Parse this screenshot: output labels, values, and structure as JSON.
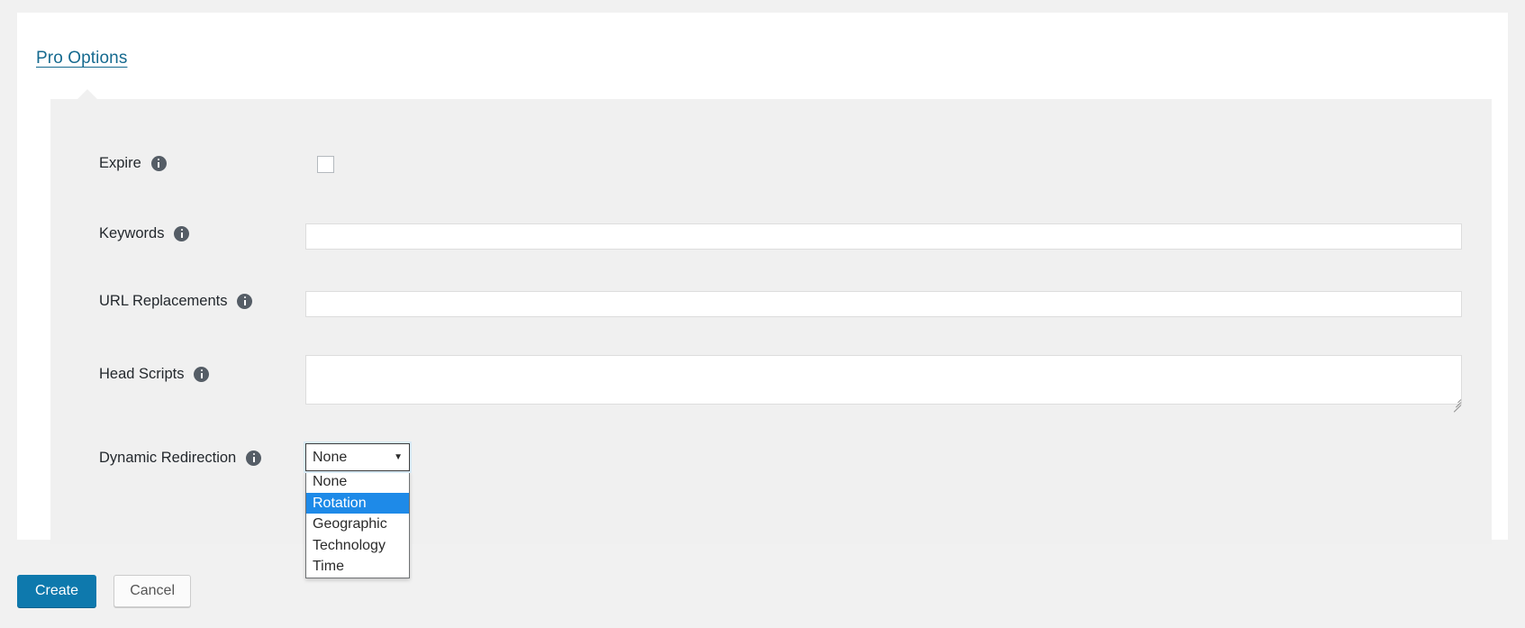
{
  "tab": {
    "label": "Pro Options"
  },
  "fields": [
    {
      "label": "Expire",
      "info_icon": "info-icon",
      "control": "checkbox",
      "value": "",
      "checked": false
    },
    {
      "label": "Keywords",
      "info_icon": "info-icon",
      "control": "text",
      "value": "",
      "placeholder": ""
    },
    {
      "label": "URL Replacements",
      "info_icon": "info-icon",
      "control": "text",
      "value": "",
      "placeholder": ""
    },
    {
      "label": "Head Scripts",
      "info_icon": "info-icon",
      "control": "textarea",
      "value": "",
      "placeholder": ""
    },
    {
      "label": "Dynamic Redirection",
      "info_icon": "info-icon",
      "control": "select",
      "value": "None"
    }
  ],
  "dropdown": {
    "selected_value": "None",
    "highlighted_option": "Rotation",
    "arrow_glyph": "▼",
    "options": [
      "None",
      "Rotation",
      "Geographic",
      "Technology",
      "Time"
    ]
  },
  "footer": {
    "create_label": "Create",
    "cancel_label": "Cancel"
  },
  "colors": {
    "link": "#156a8f",
    "primary_button": "#0e79ad",
    "highlight": "#1e8ae8",
    "panel_bg": "#f0f0f0",
    "page_bg": "#f1f1f1",
    "card_bg": "#ffffff"
  }
}
